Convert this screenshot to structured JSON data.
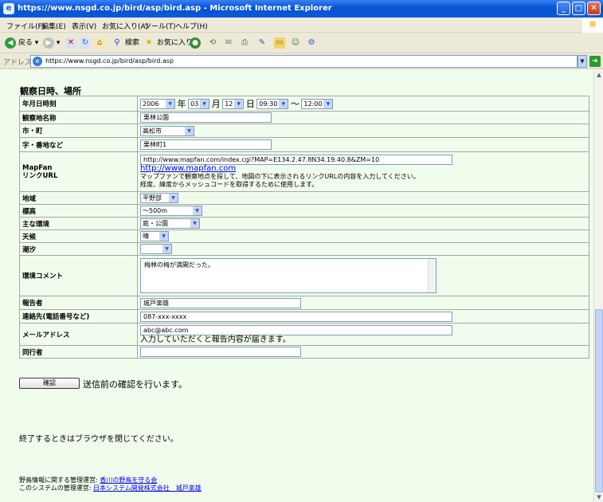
{
  "window": {
    "title": "https://www.nsgd.co.jp/bird/asp/bird.asp - Microsoft Internet Explorer",
    "minimize": "_",
    "maximize": "□",
    "close": "✕"
  },
  "menu": [
    "ファイル(F)",
    "編集(E)",
    "表示(V)",
    "お気に入り(A)",
    "ツール(T)",
    "ヘルプ(H)"
  ],
  "toolbar": {
    "back_label": "戻る",
    "search_label": "検索",
    "favorites_label": "お気に入り"
  },
  "address": {
    "label": "アドレス(D)",
    "url": "https://www.nsgd.co.jp/bird/asp/bird.asp",
    "go_label": "移動"
  },
  "form": {
    "section_title": "観察日時、場所",
    "labels": {
      "datetime": "年月日時刻",
      "place_name": "観察地名称",
      "city": "市・町",
      "address_detail": "字・番地など",
      "mapfan": "MapFan\nリンクURL",
      "region": "地域",
      "altitude": "標高",
      "environment": "主な環境",
      "weather": "天候",
      "tide": "潮汐",
      "env_comment": "環境コメント",
      "reporter": "報告者",
      "contact": "連絡先(電話番号など)",
      "email": "メールアドレス",
      "companion": "同行者"
    },
    "datetime": {
      "year": "2006",
      "year_unit": "年",
      "month": "03",
      "month_unit": "月",
      "day": "12",
      "day_unit": "日",
      "start_time": "09:30",
      "range_sep": "〜",
      "end_time": "12:00"
    },
    "place_name": "栗林公園",
    "city": "高松市",
    "address_detail": "栗林町1",
    "mapfan": {
      "url_value": "http://www.mapfan.com/index.cgi?MAP=E134.2.47.8N34.19.40.8&ZM=10",
      "link_text": "http://www.mapfan.com",
      "help_line1": "マップファンで観察地点を探して、地図の下に表示されるリンクURLの内容を入力してください。",
      "help_line2": "経度、緯度からメッシュコードを取得するために使用します。"
    },
    "region": "平野部",
    "altitude": "〜500m",
    "environment": "庭・公園",
    "weather": "晴",
    "tide": "",
    "env_comment": "梅林の梅が満開だった。",
    "reporter": "城戸楽雄",
    "contact": "087-xxx-xxxx",
    "email": "abc@abc.com",
    "email_note": "入力していただくと報告内容が届きます。",
    "companion": ""
  },
  "confirm": {
    "button_label": "確認",
    "note": "送信前の確認を行います。"
  },
  "close_note": "終了するときはブラウザを閉じてください。",
  "footer": {
    "line1_prefix": "野鳥情報に関する管理運営: ",
    "line1_link": "香川の野鳥を守る会",
    "line2_prefix": "このシステムの管理運営: ",
    "line2_link": "日本システム開発株式会社　城戸楽雄"
  }
}
